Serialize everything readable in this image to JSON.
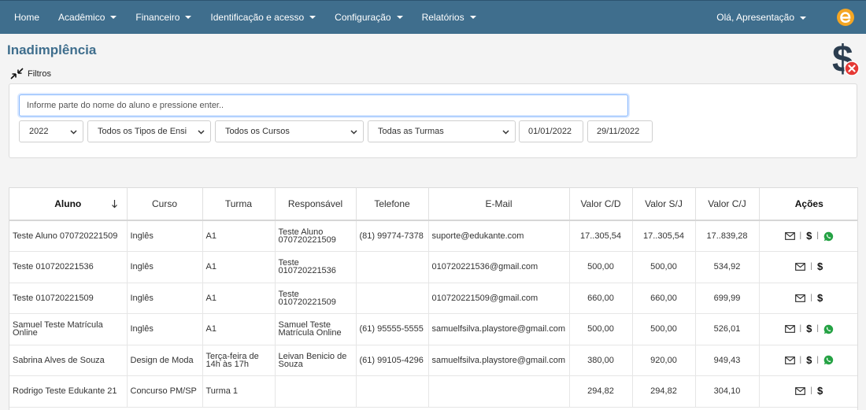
{
  "nav": {
    "items": [
      {
        "label": "Home",
        "dropdown": false
      },
      {
        "label": "Acadêmico",
        "dropdown": true
      },
      {
        "label": "Financeiro",
        "dropdown": true
      },
      {
        "label": "Identificação e acesso",
        "dropdown": true
      },
      {
        "label": "Configuração",
        "dropdown": true
      },
      {
        "label": "Relatórios",
        "dropdown": true
      }
    ],
    "user_label": "Olá, Apresentação",
    "brand_color": "#f5a623",
    "bar_color": "#3f6e8d"
  },
  "page": {
    "title": "Inadimplência",
    "filters_label": "Filtros"
  },
  "filters": {
    "search_placeholder": "Informe parte do nome do aluno e pressione enter..",
    "year": "2022",
    "tipo_ensino": "Todos os Tipos de Ensi",
    "curso": "Todos os Cursos",
    "turma": "Todas as Turmas",
    "date_from": "01/01/2022",
    "date_to": "29/11/2022"
  },
  "table": {
    "headers": {
      "aluno": "Aluno",
      "curso": "Curso",
      "turma": "Turma",
      "responsavel": "Responsável",
      "telefone": "Telefone",
      "email": "E-Mail",
      "valor_cd": "Valor C/D",
      "valor_sj": "Valor S/J",
      "valor_cj": "Valor C/J",
      "acoes": "Ações"
    },
    "rows": [
      {
        "aluno": "Teste Aluno 070720221509",
        "curso": "Inglês",
        "turma": "A1",
        "responsavel": "Teste Aluno 070720221509",
        "telefone": "(81) 99774-7378",
        "email": "suporte@edukante.com",
        "valor_cd": "17..305,54",
        "valor_sj": "17..305,54",
        "valor_cj": "17..839,28",
        "whatsapp": true
      },
      {
        "aluno": "Teste 010720221536",
        "curso": "Inglês",
        "turma": "A1",
        "responsavel": "Teste 010720221536",
        "telefone": "",
        "email": "010720221536@gmail.com",
        "valor_cd": "500,00",
        "valor_sj": "500,00",
        "valor_cj": "534,92",
        "whatsapp": false
      },
      {
        "aluno": "Teste 010720221509",
        "curso": "Inglês",
        "turma": "A1",
        "responsavel": "Teste 010720221509",
        "telefone": "",
        "email": "010720221509@gmail.com",
        "valor_cd": "660,00",
        "valor_sj": "660,00",
        "valor_cj": "699,99",
        "whatsapp": false
      },
      {
        "aluno": "Samuel Teste Matrícula Online",
        "curso": "Inglês",
        "turma": "A1",
        "responsavel": "Samuel Teste Matrícula Online",
        "telefone": "(61) 95555-5555",
        "email": "samuelfsilva.playstore@gmail.com",
        "valor_cd": "500,00",
        "valor_sj": "500,00",
        "valor_cj": "526,01",
        "whatsapp": true
      },
      {
        "aluno": "Sabrina Alves de Souza",
        "curso": "Design de Moda",
        "turma": "Terça-feira de 14h às 17h",
        "responsavel": "Leivan Benicio de Souza",
        "telefone": "(61) 99105-4296",
        "email": "samuelfsilva.playstore@gmail.com",
        "valor_cd": "380,00",
        "valor_sj": "920,00",
        "valor_cj": "949,43",
        "whatsapp": true
      },
      {
        "aluno": "Rodrigo Teste Edukante 21",
        "curso": "Concurso PM/SP",
        "turma": "Turma 1",
        "responsavel": "",
        "telefone": "",
        "email": "",
        "valor_cd": "294,82",
        "valor_sj": "294,82",
        "valor_cj": "304,10",
        "whatsapp": false
      }
    ]
  }
}
